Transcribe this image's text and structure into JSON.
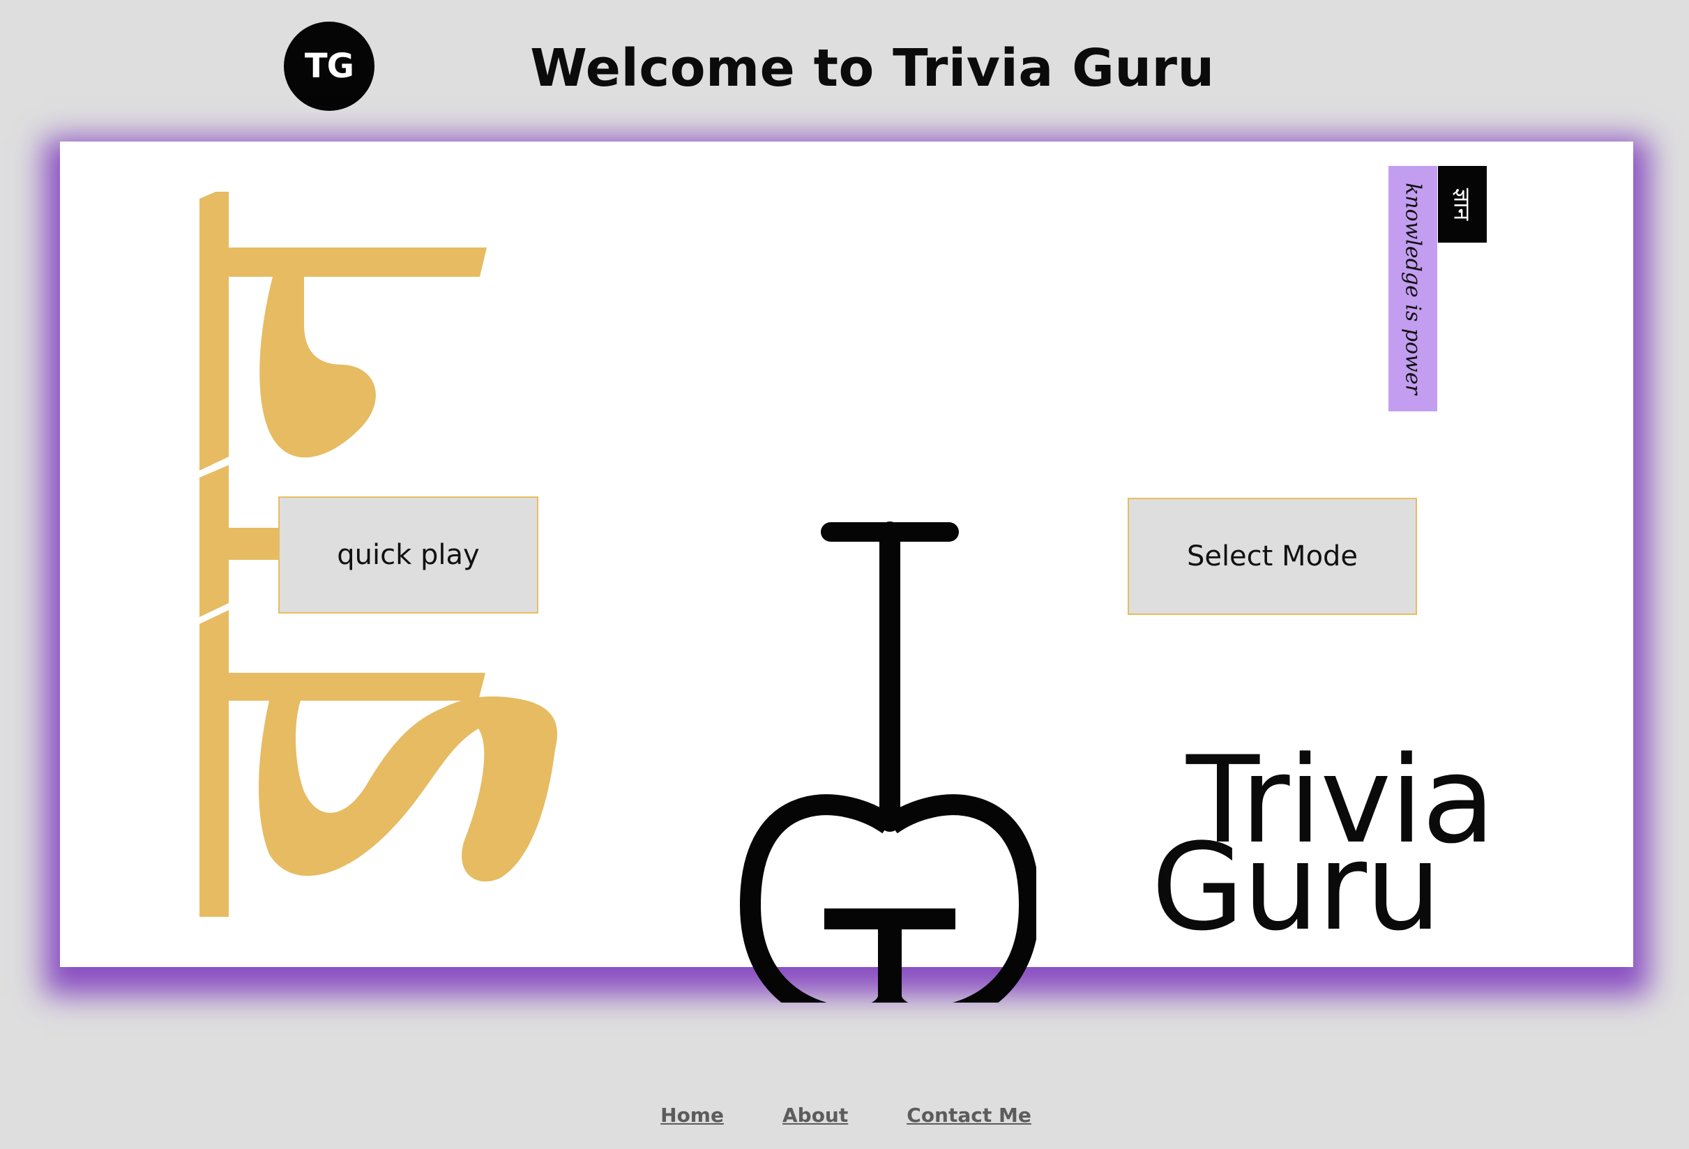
{
  "header": {
    "logo_text": "TG",
    "title": "Welcome to Trivia Guru"
  },
  "main": {
    "quick_play_label": "quick play",
    "select_mode_label": "Select Mode",
    "knowledge_tagline": "knowledge is power",
    "gyaan_label": "ज्ञान",
    "brand_line_1": "Trivia",
    "brand_line_2": "Guru",
    "gurmukhi_art_text": "ਗਿਆਨ"
  },
  "footer": {
    "links": [
      {
        "label": "Home"
      },
      {
        "label": "About"
      },
      {
        "label": "Contact Me"
      }
    ]
  },
  "colors": {
    "background": "#dedede",
    "card": "#ffffff",
    "card_glow": "#8a4fc2",
    "accent_gold": "#e6bb62",
    "tag_lavender": "#c39df0",
    "ink": "#050505",
    "button_border": "#e8bc60",
    "footer_link": "#5c5c5c"
  }
}
